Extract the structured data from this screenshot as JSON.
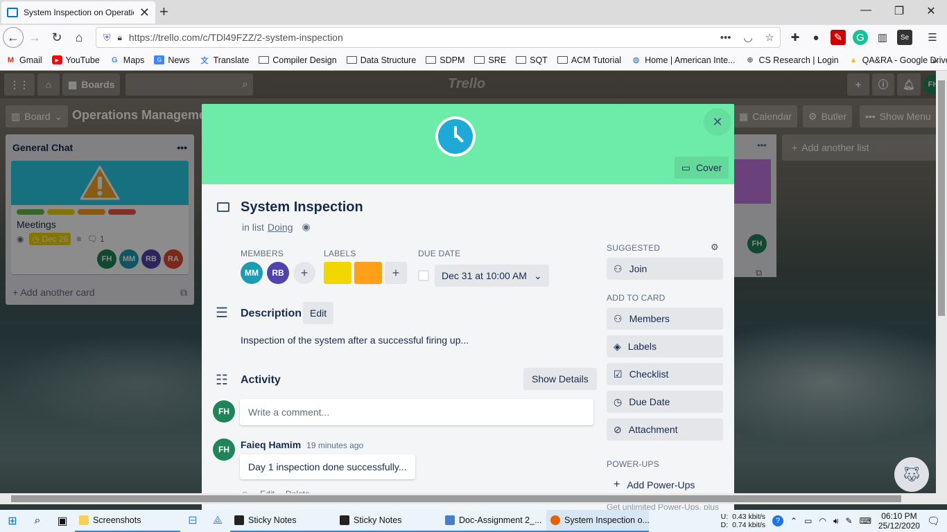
{
  "browser": {
    "tab_title": "System Inspection on Operatio",
    "url": "https://trello.com/c/TDl49FZZ/2-system-inspection",
    "bookmarks": [
      {
        "label": "Gmail",
        "icon": "gmail-icon",
        "color": "#d93025"
      },
      {
        "label": "YouTube",
        "icon": "youtube-icon",
        "color": "#ff0000"
      },
      {
        "label": "Maps",
        "icon": "google-icon",
        "color": "#4285f4"
      },
      {
        "label": "News",
        "icon": "news-icon",
        "color": "#4285f4"
      },
      {
        "label": "Translate",
        "icon": "translate-icon",
        "color": "#4285f4"
      },
      {
        "label": "Compiler Design",
        "icon": "folder-icon"
      },
      {
        "label": "Data Structure",
        "icon": "folder-icon"
      },
      {
        "label": "SDPM",
        "icon": "folder-icon"
      },
      {
        "label": "SRE",
        "icon": "folder-icon"
      },
      {
        "label": "SQT",
        "icon": "folder-icon"
      },
      {
        "label": "ACM Tutorial",
        "icon": "folder-icon"
      },
      {
        "label": "Home | American Inte...",
        "icon": "globe-icon"
      },
      {
        "label": "CS Research | Login",
        "icon": "globe-icon"
      },
      {
        "label": "QA&RA - Google Drive",
        "icon": "drive-icon"
      }
    ]
  },
  "trello": {
    "header": {
      "boards_label": "Boards",
      "logo": "Trello",
      "user_initials": "FH"
    },
    "board": {
      "board_menu_label": "Board",
      "name": "Operations Management",
      "calendar_label": "Calendar",
      "butler_label": "Butler",
      "show_menu_label": "Show Menu"
    },
    "list": {
      "title": "General Chat",
      "card": {
        "title": "Meetings",
        "due": "Dec 26",
        "comments": "1",
        "label_colors": [
          "#61bd4f",
          "#f2d600",
          "#ff9f1a",
          "#eb5a46"
        ],
        "members": [
          {
            "initials": "FH",
            "color": "#1f845a"
          },
          {
            "initials": "MM",
            "color": "#1c9bb3"
          },
          {
            "initials": "RB",
            "color": "#5243aa"
          },
          {
            "initials": "RA",
            "color": "#e2492f"
          }
        ]
      },
      "add_card": "Add another card"
    },
    "right_list_member": "FH",
    "add_list": "Add another list"
  },
  "modal": {
    "cover_label": "Cover",
    "cover_color": "#6deca9",
    "title": "System Inspection",
    "in_list_prefix": "in list",
    "list_name": "Doing",
    "members_label": "MEMBERS",
    "members": [
      {
        "initials": "MM",
        "color": "#1c9bb3"
      },
      {
        "initials": "RB",
        "color": "#5243aa"
      }
    ],
    "labels_label": "LABELS",
    "label_colors": [
      "#f2d600",
      "#ff9f1a"
    ],
    "due_label": "DUE DATE",
    "due_value": "Dec 31 at 10:00 AM",
    "description_title": "Description",
    "edit_label": "Edit",
    "description": "Inspection of the system after a successful firing up...",
    "activity_title": "Activity",
    "show_details": "Show Details",
    "comment_placeholder": "Write a comment...",
    "comment": {
      "author_initials": "FH",
      "author": "Faieq Hamim",
      "time": "19 minutes ago",
      "text": "Day 1 inspection done successfully...",
      "edit": "Edit",
      "delete": "Delete"
    },
    "sidebar": {
      "suggested_label": "SUGGESTED",
      "join": "Join",
      "add_to_card_label": "ADD TO CARD",
      "items": [
        "Members",
        "Labels",
        "Checklist",
        "Due Date",
        "Attachment"
      ],
      "powerups_label": "POWER-UPS",
      "add_powerups": "Add Power-Ups",
      "footer": "Get unlimited Power-Ups, plus"
    }
  },
  "taskbar": {
    "apps": [
      {
        "label": "Screenshots",
        "color": "#f7d154"
      },
      {
        "label": "Sticky Notes",
        "color": "#222222"
      },
      {
        "label": "Sticky Notes",
        "color": "#222222"
      },
      {
        "label": "Doc-Assignment 2_...",
        "color": "#4a7fc1"
      },
      {
        "label": "System Inspection o...",
        "color": "#e66000"
      }
    ],
    "net_up_label": "U:",
    "net_up": "0.43 kbit/s",
    "net_down_label": "D:",
    "net_down": "0.74 kbit/s",
    "time": "06:10 PM",
    "date": "25/12/2020"
  }
}
